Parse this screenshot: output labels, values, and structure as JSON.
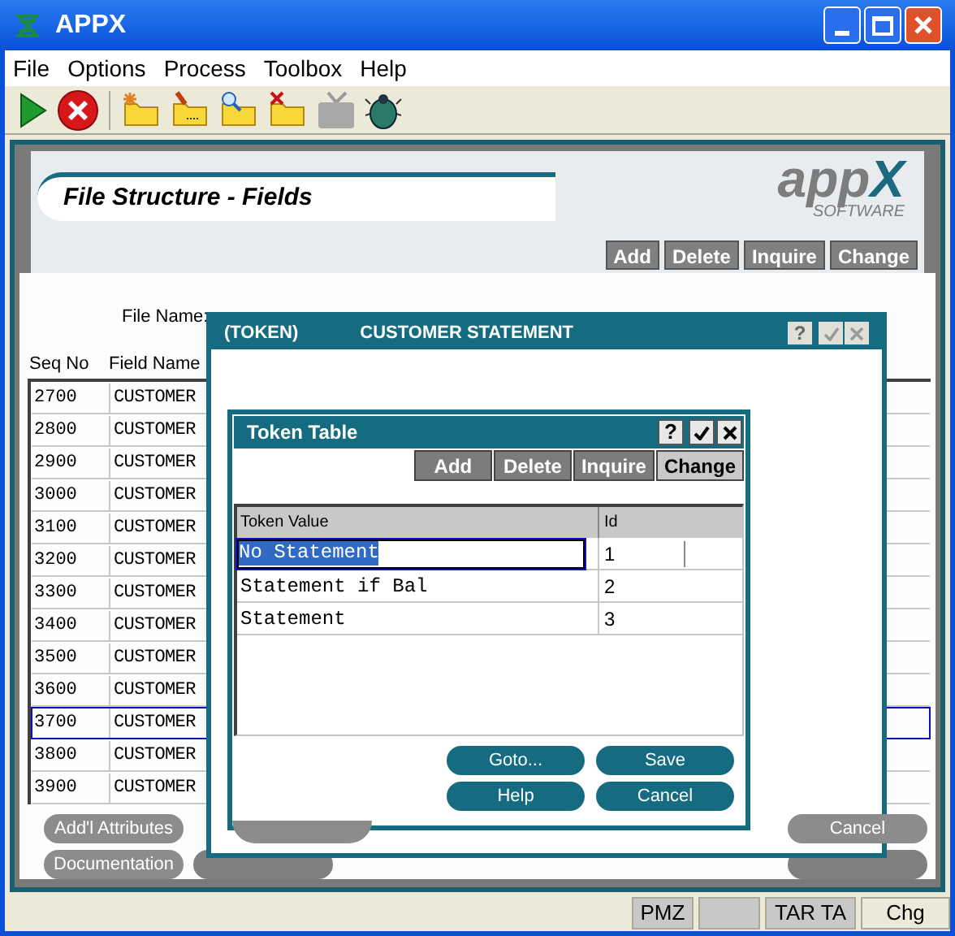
{
  "window": {
    "title": "APPX"
  },
  "menu": [
    "File",
    "Options",
    "Process",
    "Toolbox",
    "Help"
  ],
  "toolbar": [
    {
      "kind": "run",
      "disabled": false
    },
    {
      "kind": "stop",
      "disabled": false
    },
    {
      "kind": "sep"
    },
    {
      "kind": "new",
      "disabled": false
    },
    {
      "kind": "edit",
      "disabled": false
    },
    {
      "kind": "find",
      "disabled": false
    },
    {
      "kind": "delete",
      "disabled": false
    },
    {
      "kind": "tv",
      "disabled": true
    },
    {
      "kind": "bug",
      "disabled": false
    }
  ],
  "screen": {
    "title": "File Structure - Fields",
    "logo": "app",
    "logo_x": "X",
    "logo_sub": "SOFTWARE",
    "actions": [
      {
        "label": "Add",
        "selected": false
      },
      {
        "label": "Delete",
        "selected": false
      },
      {
        "label": "Inquire",
        "selected": false
      },
      {
        "label": "Change",
        "selected": false
      }
    ],
    "file_name_label": "File Name:",
    "table": {
      "columns": [
        "Seq No",
        "Field Name"
      ],
      "rows": [
        {
          "seq": "2700",
          "name": "CUSTOMER",
          "selected": false
        },
        {
          "seq": "2800",
          "name": "CUSTOMER",
          "selected": false
        },
        {
          "seq": "2900",
          "name": "CUSTOMER",
          "selected": false
        },
        {
          "seq": "3000",
          "name": "CUSTOMER",
          "selected": false
        },
        {
          "seq": "3100",
          "name": "CUSTOMER",
          "selected": false
        },
        {
          "seq": "3200",
          "name": "CUSTOMER",
          "selected": false
        },
        {
          "seq": "3300",
          "name": "CUSTOMER",
          "selected": false
        },
        {
          "seq": "3400",
          "name": "CUSTOMER",
          "selected": false
        },
        {
          "seq": "3500",
          "name": "CUSTOMER",
          "selected": false
        },
        {
          "seq": "3600",
          "name": "CUSTOMER",
          "selected": false
        },
        {
          "seq": "3700",
          "name": "CUSTOMER",
          "selected": true
        },
        {
          "seq": "3800",
          "name": "CUSTOMER",
          "selected": false
        },
        {
          "seq": "3900",
          "name": "CUSTOMER",
          "selected": false
        }
      ]
    },
    "buttons": [
      "Add'l Attributes",
      "Documentation",
      "Cancel"
    ]
  },
  "token_dialog": {
    "title": "(TOKEN)",
    "subtitle": "CUSTOMER STATEMENT",
    "help": "?"
  },
  "token_table": {
    "title": "Token Table",
    "help": "?",
    "actions": [
      {
        "label": "Add",
        "selected": false
      },
      {
        "label": "Delete",
        "selected": false
      },
      {
        "label": "Inquire",
        "selected": false
      },
      {
        "label": "Change",
        "selected": true
      }
    ],
    "columns": [
      "Token Value",
      "Id"
    ],
    "rows": [
      {
        "value": "No Statement",
        "id": "1",
        "editing": true
      },
      {
        "value": "Statement if Bal",
        "id": "2",
        "editing": false
      },
      {
        "value": "Statement",
        "id": "3",
        "editing": false
      }
    ],
    "buttons": [
      "Goto...",
      "Save",
      "Help",
      "Cancel"
    ]
  },
  "status_bar": [
    {
      "kind": "text",
      "text": "PMZ"
    },
    {
      "kind": "blank"
    },
    {
      "kind": "text",
      "text": "TAR TA"
    },
    {
      "kind": "text",
      "text": "Chg"
    }
  ]
}
